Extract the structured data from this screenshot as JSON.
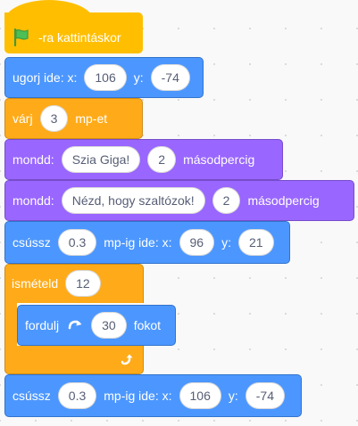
{
  "script": {
    "hat": {
      "label": "-ra kattintáskor",
      "icon": "green-flag-icon",
      "color": "#ffbf00"
    },
    "goto": {
      "label": "ugorj ide: x:",
      "x": "106",
      "y_label": "y:",
      "y": "-74"
    },
    "wait": {
      "label": "várj",
      "seconds": "3",
      "unit": "mp-et"
    },
    "say1": {
      "label": "mondd:",
      "message": "Szia Giga!",
      "seconds": "2",
      "unit": "másodpercig"
    },
    "say2": {
      "label": "mondd:",
      "message": "Nézd, hogy szaltózok!",
      "seconds": "2",
      "unit": "másodpercig"
    },
    "glide1": {
      "label": "csússz",
      "seconds": "0.3",
      "to_label": "mp-ig ide: x:",
      "x": "96",
      "y_label": "y:",
      "y": "21"
    },
    "repeat": {
      "label": "ismételd",
      "times": "12",
      "loop_icon": "loop-arrow-icon"
    },
    "turn": {
      "label": "fordulj",
      "icon": "rotate-right-icon",
      "degrees": "30",
      "unit": "fokot"
    },
    "glide2": {
      "label": "csússz",
      "seconds": "0.3",
      "to_label": "mp-ig ide: x:",
      "x": "106",
      "y_label": "y:",
      "y": "-74"
    }
  },
  "colors": {
    "events": "#ffbf00",
    "motion": "#4c97ff",
    "control": "#ffab19",
    "looks": "#9966ff"
  }
}
